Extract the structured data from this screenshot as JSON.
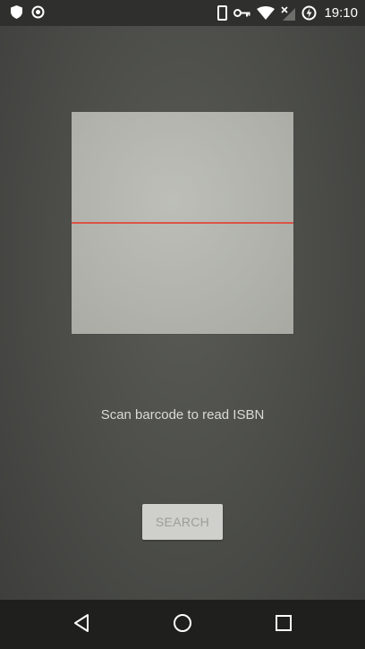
{
  "status_bar": {
    "time": "19:10",
    "icons": [
      "shield-icon",
      "target-icon",
      "phone-icon",
      "key-icon",
      "wifi-icon",
      "no-signal-icon",
      "battery-charging-icon"
    ]
  },
  "scanner": {
    "hint": "Scan barcode to read ISBN",
    "scan_line_color": "#e0483b"
  },
  "actions": {
    "search_label": "SEARCH",
    "search_enabled": false
  },
  "navigation": {
    "buttons": [
      "back-icon",
      "home-icon",
      "recents-icon"
    ]
  }
}
